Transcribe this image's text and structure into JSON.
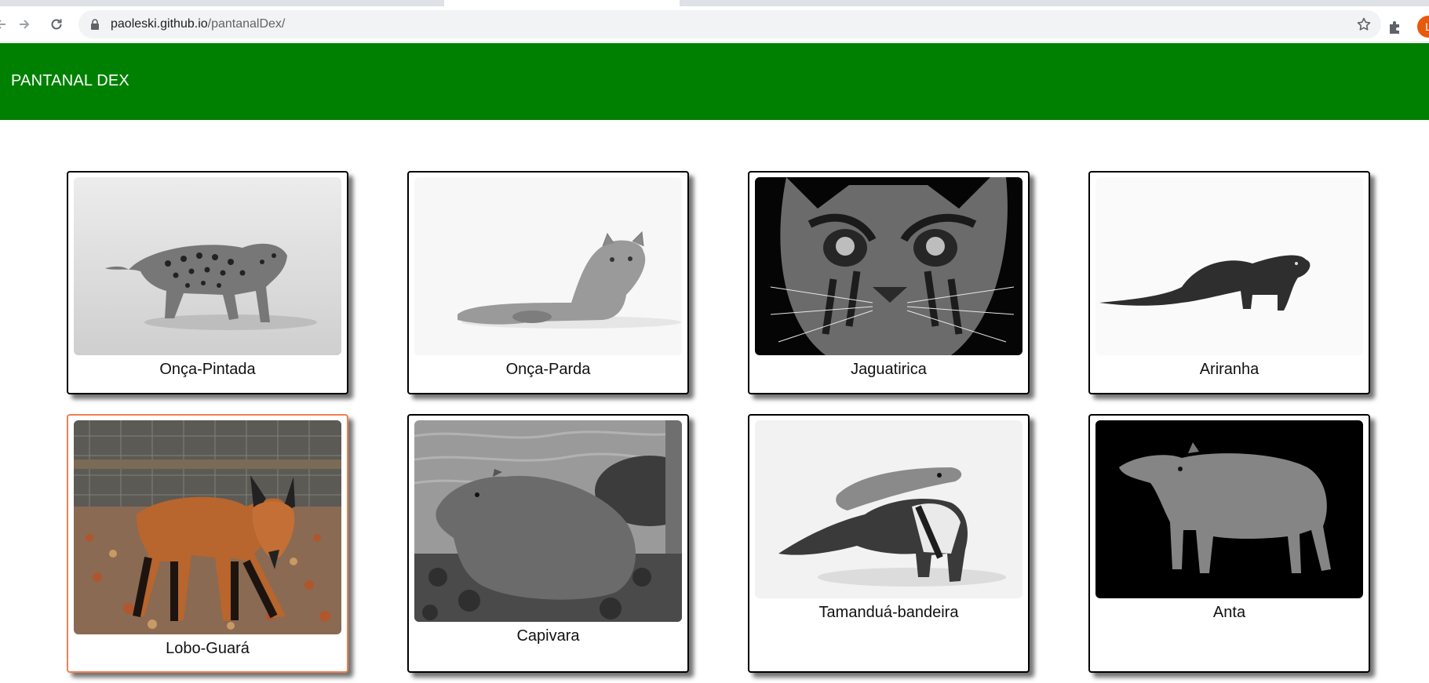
{
  "browser": {
    "url_host": "paoleski.github.io",
    "url_path": "/pantanalDex/",
    "avatar_letter": "L"
  },
  "header": {
    "title": "PANTANAL DEX",
    "background": "#008000"
  },
  "animals": [
    {
      "name": "Onça-Pintada",
      "image": "jaguar-photo",
      "tone": "grayscale"
    },
    {
      "name": "Onça-Parda",
      "image": "puma-photo",
      "tone": "grayscale"
    },
    {
      "name": "Jaguatirica",
      "image": "ocelot-photo",
      "tone": "grayscale"
    },
    {
      "name": "Ariranha",
      "image": "giant-otter-photo",
      "tone": "grayscale"
    },
    {
      "name": "Lobo-Guará",
      "image": "maned-wolf-photo",
      "tone": "color"
    },
    {
      "name": "Capivara",
      "image": "capybara-photo",
      "tone": "grayscale"
    },
    {
      "name": "Tamanduá-bandeira",
      "image": "giant-anteater-photo",
      "tone": "grayscale"
    },
    {
      "name": "Anta",
      "image": "tapir-photo",
      "tone": "grayscale"
    }
  ]
}
